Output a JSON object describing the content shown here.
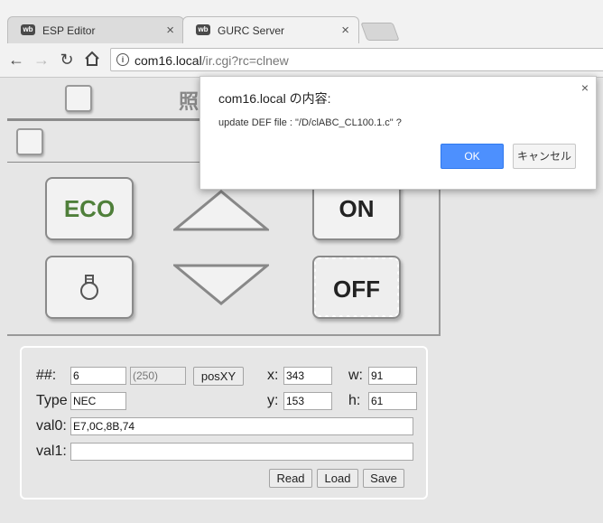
{
  "browser": {
    "tabs": [
      {
        "title": "ESP Editor",
        "active": false
      },
      {
        "title": "GURC Server",
        "active": true
      }
    ],
    "close_glyph": "×",
    "url": {
      "host": "com16.local",
      "path": "/ir.cgi?rc=clnew"
    },
    "icons": [
      "back-arrow-icon",
      "forward-arrow-icon",
      "reload-icon",
      "home-icon",
      "info-icon"
    ]
  },
  "remote": {
    "header_text": "照",
    "buttons": {
      "eco": "ECO",
      "on": "ON",
      "off": "OFF",
      "bulb_icon": "light-bulb-icon"
    },
    "colors": {
      "eco_text": "#4f7f3a",
      "panel_line": "#8c8c8c"
    }
  },
  "form": {
    "num_label": "##:",
    "num_value": "6",
    "num_extra": "(250)",
    "posxy_label": "posXY",
    "x_label": "x:",
    "x_value": "343",
    "w_label": "w:",
    "w_value": "91",
    "type_label": "Type",
    "type_value": "NEC",
    "y_label": "y:",
    "y_value": "153",
    "h_label": "h:",
    "h_value": "61",
    "val0_label": "val0:",
    "val0_value": "E7,0C,8B,74",
    "val1_label": "val1:",
    "val1_value": "",
    "read_label": "Read",
    "load_label": "Load",
    "save_label": "Save"
  },
  "dialog": {
    "title": "com16.local の内容:",
    "message": "update DEF file : \"/D/clABC_CL100.1.c\" ?",
    "ok_label": "OK",
    "cancel_label": "キャンセル",
    "close_glyph": "×",
    "accent": "#4d90fe"
  }
}
